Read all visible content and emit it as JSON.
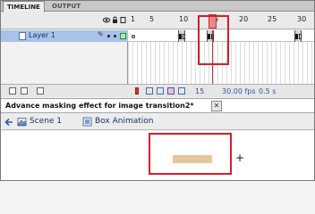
{
  "panel_tabs": [
    {
      "label": "TIMELINE"
    },
    {
      "label": "OUTPUT"
    }
  ],
  "timeline": {
    "header_icons": [
      "eye-icon",
      "lock-icon",
      "outline-icon"
    ],
    "ruler_labels": [
      "1",
      "5",
      "10",
      "15",
      "20",
      "25",
      "30"
    ],
    "current_frame_highlight": "15",
    "layer": {
      "name": "Layer 1",
      "icon": "layer-page-icon"
    },
    "footer": {
      "current_frame": "15",
      "frame_rate": "30.00 fps",
      "elapsed_time": "0.5 s"
    }
  },
  "document": {
    "tab_title": "Advance masking effect for image transition2*",
    "close_symbol": "✕"
  },
  "edit_bar": {
    "breadcrumbs": [
      {
        "label": "Scene 1",
        "icon": "scene-icon"
      },
      {
        "label": "Box Animation",
        "icon": "symbol-icon"
      }
    ]
  },
  "stage": {
    "registration_point": "+"
  },
  "colors": {
    "highlight": "#d41f2a",
    "layer_selected": "#a8c2e8",
    "shape_fill": "#e9c39a",
    "playhead": "#d03030"
  }
}
